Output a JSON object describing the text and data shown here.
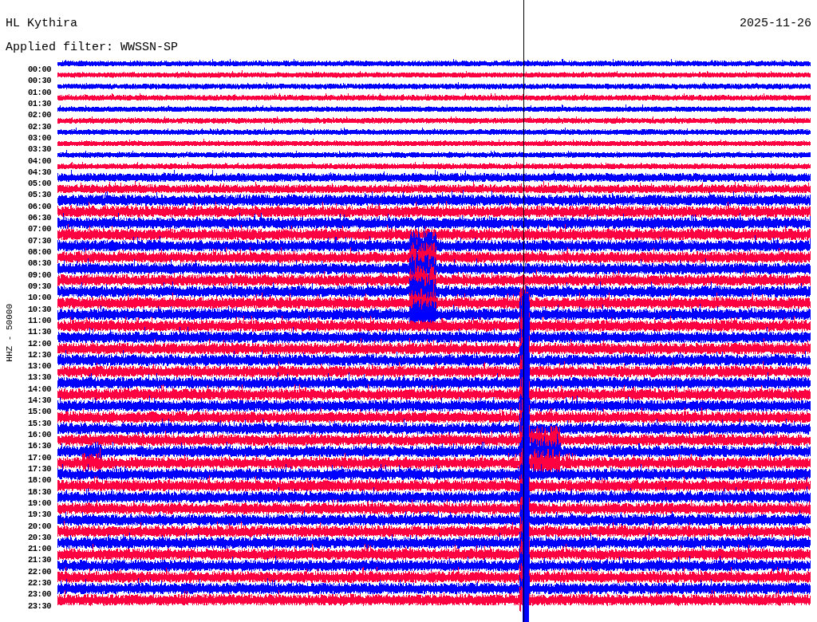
{
  "station": "HL Kythira",
  "date": "2025-11-26",
  "filter": "Applied filter: WWSSN-SP",
  "channel_label": "HHZ - 50000",
  "rows": [
    {
      "time": "00:00",
      "color": "#0000ff"
    },
    {
      "time": "00:30",
      "color": "#ff0040"
    },
    {
      "time": "01:00",
      "color": "#0000ff"
    },
    {
      "time": "01:30",
      "color": "#ff0040"
    },
    {
      "time": "02:00",
      "color": "#0000ff"
    },
    {
      "time": "02:30",
      "color": "#ff0040"
    },
    {
      "time": "03:00",
      "color": "#0000ff"
    },
    {
      "time": "03:30",
      "color": "#ff0040"
    },
    {
      "time": "04:00",
      "color": "#0000ff"
    },
    {
      "time": "04:30",
      "color": "#ff0040"
    },
    {
      "time": "05:00",
      "color": "#0000ff"
    },
    {
      "time": "05:30",
      "color": "#ff0040"
    },
    {
      "time": "06:00",
      "color": "#0000ff"
    },
    {
      "time": "06:30",
      "color": "#ff0040"
    },
    {
      "time": "07:00",
      "color": "#0000ff"
    },
    {
      "time": "07:30",
      "color": "#ff0040"
    },
    {
      "time": "08:00",
      "color": "#0000ff"
    },
    {
      "time": "08:30",
      "color": "#ff0040"
    },
    {
      "time": "09:00",
      "color": "#0000ff"
    },
    {
      "time": "09:30",
      "color": "#ff0040"
    },
    {
      "time": "10:00",
      "color": "#0000ff"
    },
    {
      "time": "10:30",
      "color": "#ff0040"
    },
    {
      "time": "11:00",
      "color": "#0000ff"
    },
    {
      "time": "11:30",
      "color": "#ff0040"
    },
    {
      "time": "12:00",
      "color": "#0000ff"
    },
    {
      "time": "12:30",
      "color": "#ff0040"
    },
    {
      "time": "13:00",
      "color": "#0000ff"
    },
    {
      "time": "13:30",
      "color": "#ff0040"
    },
    {
      "time": "14:00",
      "color": "#0000ff"
    },
    {
      "time": "14:30",
      "color": "#ff0040"
    },
    {
      "time": "15:00",
      "color": "#0000ff"
    },
    {
      "time": "15:30",
      "color": "#ff0040"
    },
    {
      "time": "16:00",
      "color": "#0000ff"
    },
    {
      "time": "16:30",
      "color": "#ff0040"
    },
    {
      "time": "17:00",
      "color": "#0000ff"
    },
    {
      "time": "17:30",
      "color": "#ff0040"
    },
    {
      "time": "18:00",
      "color": "#0000ff"
    },
    {
      "time": "18:30",
      "color": "#ff0040"
    },
    {
      "time": "19:00",
      "color": "#0000ff"
    },
    {
      "time": "19:30",
      "color": "#ff0040"
    },
    {
      "time": "20:00",
      "color": "#0000ff"
    },
    {
      "time": "20:30",
      "color": "#ff0040"
    },
    {
      "time": "21:00",
      "color": "#0000ff"
    },
    {
      "time": "21:30",
      "color": "#ff0040"
    },
    {
      "time": "22:00",
      "color": "#0000ff"
    },
    {
      "time": "22:30",
      "color": "#ff0040"
    },
    {
      "time": "23:00",
      "color": "#0000ff"
    },
    {
      "time": "23:30",
      "color": "#ff0040"
    }
  ]
}
